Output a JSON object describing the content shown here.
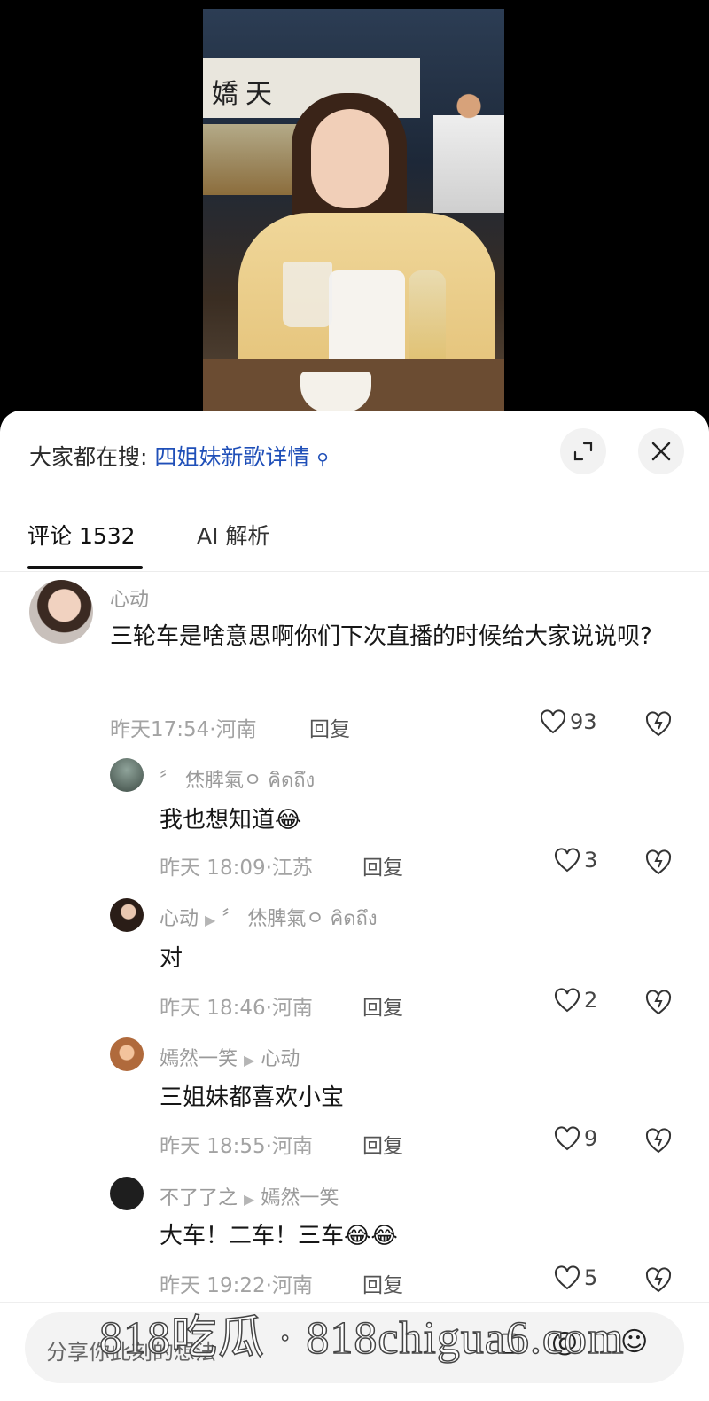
{
  "header": {
    "search_prefix": "大家都在搜:",
    "search_link": "四姐妹新歌详情",
    "video_sign": "嬌天"
  },
  "tabs": [
    {
      "label": "评论 1532",
      "active": true
    },
    {
      "label": "AI 解析",
      "active": false
    }
  ],
  "comments": [
    {
      "name": "心动",
      "text": "三轮车是啥意思啊你们下次直播的时候给大家说说呗?",
      "time": "昨天17:54·河南",
      "reply": "回复",
      "likes": "93"
    },
    {
      "name": "〞 烋脾氣ㅇ คิดถึง",
      "text": "我也想知道😂",
      "time": "昨天 18:09·江苏",
      "reply": "回复",
      "likes": "3"
    },
    {
      "name": "心动",
      "to": "〞 烋脾氣ㅇ คิดถึง",
      "text": "对",
      "time": "昨天 18:46·河南",
      "reply": "回复",
      "likes": "2"
    },
    {
      "name": "嫣然一笑",
      "to": "心动",
      "text": "三姐妹都喜欢小宝",
      "time": "昨天 18:55·河南",
      "reply": "回复",
      "likes": "9"
    },
    {
      "name": "不了了之",
      "to": "嫣然一笑",
      "text": "大车！二车！三车😂😂",
      "time": "昨天 19:22·河南",
      "reply": "回复",
      "likes": "5"
    }
  ],
  "input": {
    "placeholder": "分享你此刻的想法"
  },
  "watermark": "818吃瓜 · 818chigua6.com",
  "icons": {
    "collapse": "collapse-icon",
    "close": "close-icon",
    "like": "heart-icon",
    "dislike": "broken-heart-icon"
  },
  "colors": {
    "link": "#1f4fb8",
    "meta": "#a3a3a3",
    "sheet": "#ffffff"
  }
}
